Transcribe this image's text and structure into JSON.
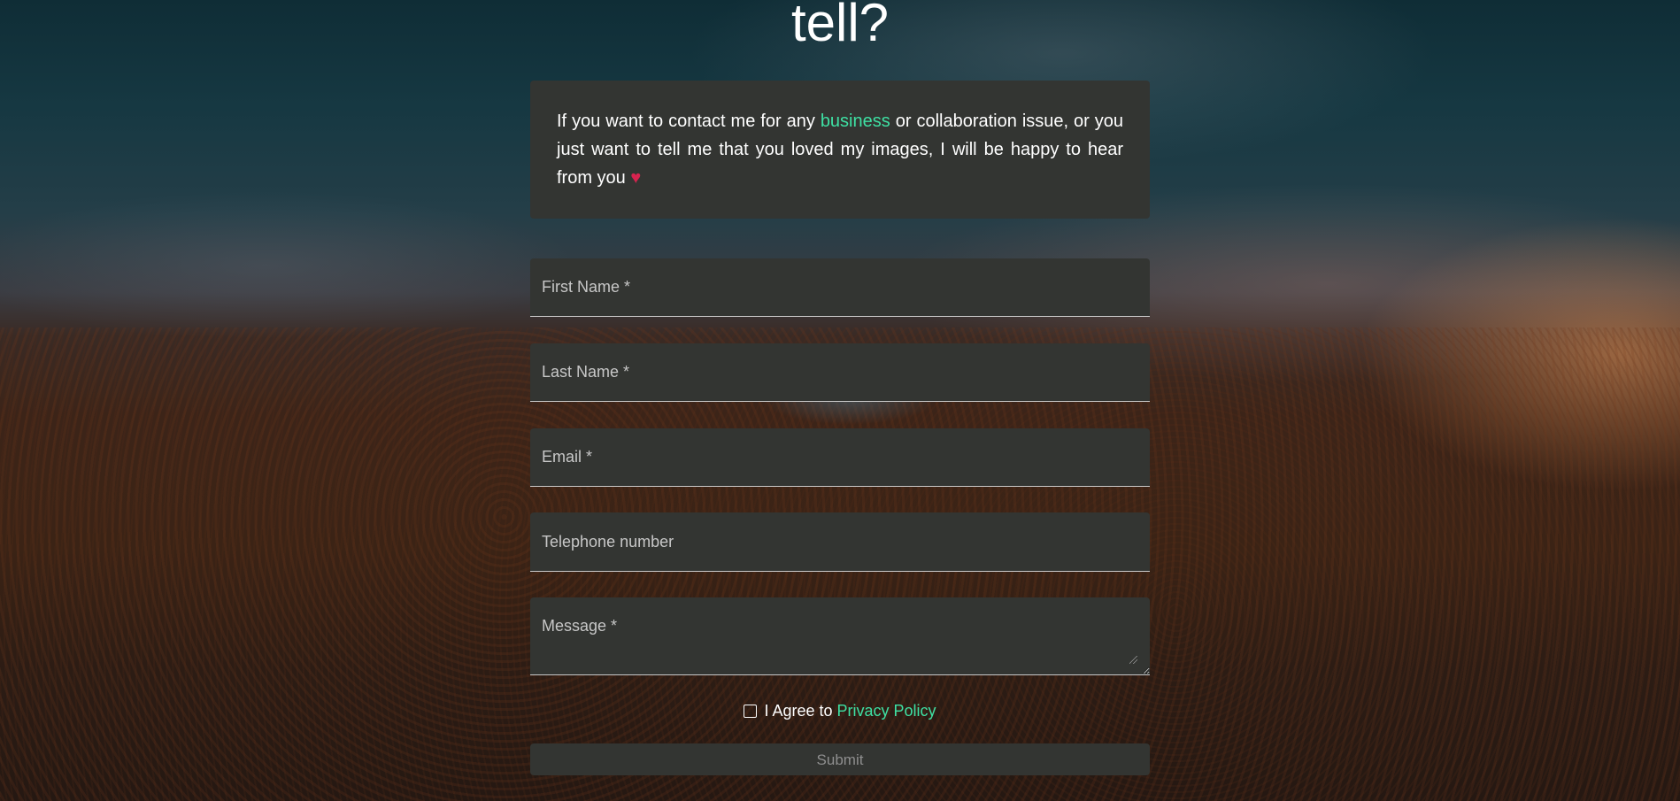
{
  "header": {
    "title": "tell?"
  },
  "intro": {
    "text_before": "If you want to contact me for any ",
    "accent_word": "business",
    "text_after": " or collaboration issue, or you just want to tell me that you loved my images, I will be happy to hear from you ",
    "heart": "♥",
    "accent_color": "#3ee0a3",
    "heart_color": "#d8234f"
  },
  "form": {
    "first_name": {
      "placeholder": "First Name *",
      "value": ""
    },
    "last_name": {
      "placeholder": "Last Name *",
      "value": ""
    },
    "email": {
      "placeholder": "Email *",
      "value": ""
    },
    "telephone": {
      "placeholder": "Telephone number",
      "value": ""
    },
    "message": {
      "placeholder": "Message *",
      "value": ""
    },
    "agree_text": "I Agree to ",
    "privacy_link": "Privacy Policy",
    "agree_checked": false,
    "submit_label": "Submit"
  }
}
